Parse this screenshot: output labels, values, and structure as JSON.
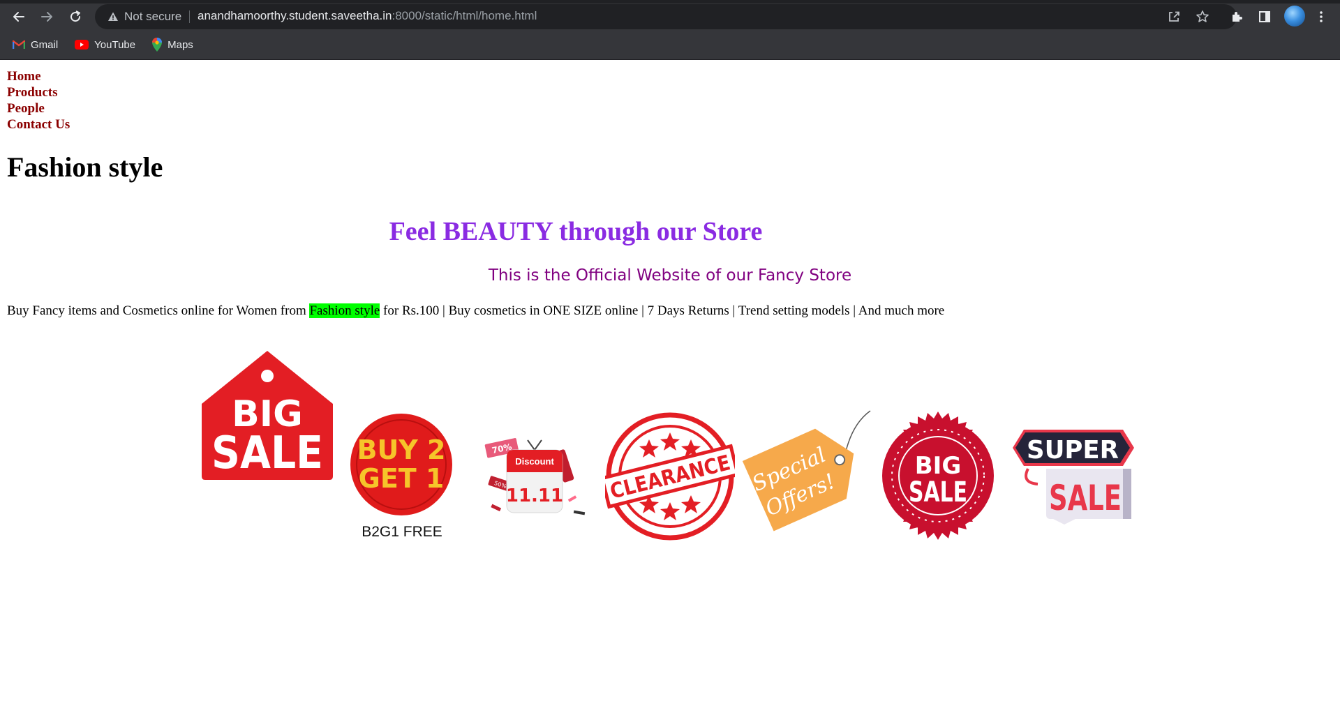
{
  "browser": {
    "security_label": "Not secure",
    "url_host": "anandhamoorthy.student.saveetha.in",
    "url_rest": ":8000/static/html/home.html",
    "bookmarks": [
      {
        "label": "Gmail",
        "icon": "gmail-icon"
      },
      {
        "label": "YouTube",
        "icon": "youtube-icon"
      },
      {
        "label": "Maps",
        "icon": "maps-icon"
      }
    ]
  },
  "nav": {
    "items": [
      {
        "label": "Home"
      },
      {
        "label": "Products"
      },
      {
        "label": "People"
      },
      {
        "label": "Contact Us"
      }
    ]
  },
  "page": {
    "brand": "Fashion style",
    "tagline": "Feel BEAUTY through our Store",
    "subtitle": "This is the Official Website of our Fancy Store",
    "description": {
      "before": "Buy Fancy items and Cosmetics online for Women from ",
      "highlight": "Fashion style",
      "after": " for Rs.100 | Buy cosmetics in ONE SIZE online | 7 Days Returns | Trend setting models | And much more"
    }
  },
  "badges": {
    "big_sale_tag": {
      "line1": "BIG",
      "line2": "SALE"
    },
    "buy2get1": {
      "line1": "BUY 2",
      "line2": "GET 1",
      "caption": "B2G1 FREE"
    },
    "discount_calendar": {
      "label": "Discount",
      "date": "11.11",
      "percent": "70%",
      "percent2": "50%"
    },
    "clearance": {
      "label": "CLEARANCE"
    },
    "special_offers": {
      "line1": "Special",
      "line2": "Offers!"
    },
    "big_sale_seal": {
      "line1": "BIG",
      "line2": "SALE"
    },
    "super_sale": {
      "line1": "SUPER",
      "line2": "SALE"
    }
  },
  "colors": {
    "nav_link": "#8b0000",
    "tagline": "#8a2be2",
    "subtitle": "#800080",
    "highlight": "#00ff00",
    "badge_red": "#e31e24"
  }
}
